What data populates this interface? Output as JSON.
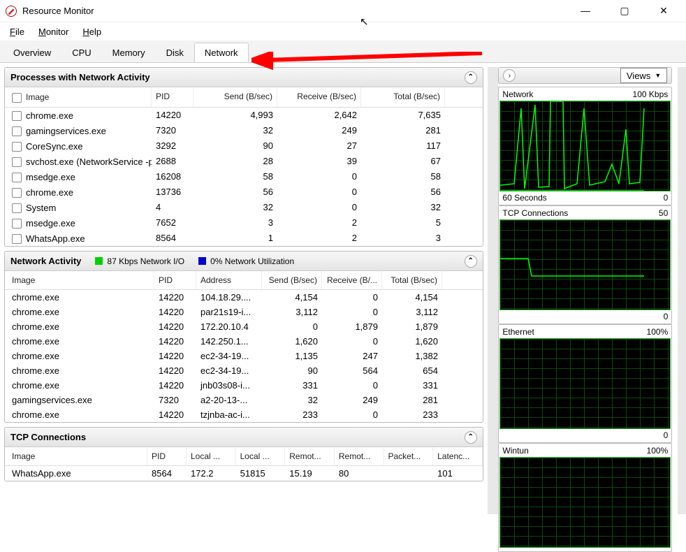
{
  "window": {
    "title": "Resource Monitor"
  },
  "menu": {
    "file": "File",
    "monitor": "Monitor",
    "help": "Help"
  },
  "tabs": {
    "overview": "Overview",
    "cpu": "CPU",
    "memory": "Memory",
    "disk": "Disk",
    "network": "Network"
  },
  "panels": {
    "procs": {
      "title": "Processes with Network Activity",
      "cols": {
        "image": "Image",
        "pid": "PID",
        "send": "Send (B/sec)",
        "recv": "Receive (B/sec)",
        "total": "Total (B/sec)"
      },
      "rows": [
        {
          "image": "chrome.exe",
          "pid": "14220",
          "send": "4,993",
          "recv": "2,642",
          "total": "7,635"
        },
        {
          "image": "gamingservices.exe",
          "pid": "7320",
          "send": "32",
          "recv": "249",
          "total": "281"
        },
        {
          "image": "CoreSync.exe",
          "pid": "3292",
          "send": "90",
          "recv": "27",
          "total": "117"
        },
        {
          "image": "svchost.exe (NetworkService -p)",
          "pid": "2688",
          "send": "28",
          "recv": "39",
          "total": "67"
        },
        {
          "image": "msedge.exe",
          "pid": "16208",
          "send": "58",
          "recv": "0",
          "total": "58"
        },
        {
          "image": "chrome.exe",
          "pid": "13736",
          "send": "56",
          "recv": "0",
          "total": "56"
        },
        {
          "image": "System",
          "pid": "4",
          "send": "32",
          "recv": "0",
          "total": "32"
        },
        {
          "image": "msedge.exe",
          "pid": "7652",
          "send": "3",
          "recv": "2",
          "total": "5"
        },
        {
          "image": "WhatsApp.exe",
          "pid": "8564",
          "send": "1",
          "recv": "2",
          "total": "3"
        }
      ]
    },
    "activity": {
      "title": "Network Activity",
      "status1": "87 Kbps Network I/O",
      "status2": "0% Network Utilization",
      "cols": {
        "image": "Image",
        "pid": "PID",
        "addr": "Address",
        "send": "Send (B/sec)",
        "recv": "Receive (B/...",
        "total": "Total (B/sec)"
      },
      "rows": [
        {
          "image": "chrome.exe",
          "pid": "14220",
          "addr": "104.18.29....",
          "send": "4,154",
          "recv": "0",
          "total": "4,154"
        },
        {
          "image": "chrome.exe",
          "pid": "14220",
          "addr": "par21s19-i...",
          "send": "3,112",
          "recv": "0",
          "total": "3,112"
        },
        {
          "image": "chrome.exe",
          "pid": "14220",
          "addr": "172.20.10.4",
          "send": "0",
          "recv": "1,879",
          "total": "1,879"
        },
        {
          "image": "chrome.exe",
          "pid": "14220",
          "addr": "142.250.1...",
          "send": "1,620",
          "recv": "0",
          "total": "1,620"
        },
        {
          "image": "chrome.exe",
          "pid": "14220",
          "addr": "ec2-34-19...",
          "send": "1,135",
          "recv": "247",
          "total": "1,382"
        },
        {
          "image": "chrome.exe",
          "pid": "14220",
          "addr": "ec2-34-19...",
          "send": "90",
          "recv": "564",
          "total": "654"
        },
        {
          "image": "chrome.exe",
          "pid": "14220",
          "addr": "jnb03s08-i...",
          "send": "331",
          "recv": "0",
          "total": "331"
        },
        {
          "image": "gamingservices.exe",
          "pid": "7320",
          "addr": "a2-20-13-...",
          "send": "32",
          "recv": "249",
          "total": "281"
        },
        {
          "image": "chrome.exe",
          "pid": "14220",
          "addr": "tzjnba-ac-i...",
          "send": "233",
          "recv": "0",
          "total": "233"
        }
      ]
    },
    "tcp": {
      "title": "TCP Connections",
      "cols": {
        "image": "Image",
        "pid": "PID",
        "la": "Local ...",
        "lp": "Local ...",
        "ra": "Remot...",
        "rp": "Remot...",
        "pl": "Packet...",
        "lat": "Latenc..."
      },
      "rows": [
        {
          "image": "WhatsApp.exe",
          "pid": "8564",
          "la": "172.2",
          "lp": "51815",
          "ra": "15.19",
          "rp": "80",
          "pl": "",
          "lat": "101"
        }
      ]
    }
  },
  "right": {
    "views": "Views",
    "graphs": [
      {
        "title": "Network",
        "right": "100 Kbps",
        "footL": "60 Seconds",
        "footR": "0"
      },
      {
        "title": "TCP Connections",
        "right": "50",
        "footL": "",
        "footR": "0"
      },
      {
        "title": "Ethernet",
        "right": "100%",
        "footL": "",
        "footR": "0"
      },
      {
        "title": "Wintun",
        "right": "100%",
        "footL": "",
        "footR": ""
      }
    ]
  },
  "colors": {
    "io": "#00d000",
    "util": "#0000d0"
  }
}
